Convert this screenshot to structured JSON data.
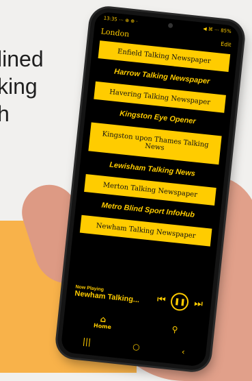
{
  "backdrop": {
    "text_lines": [
      "lined",
      "king",
      "h"
    ]
  },
  "statusbar": {
    "time": "13:35 ⋯ ⊕ ⊕ ·",
    "icons": "◀ ⌘ ⋯ 85%"
  },
  "header": {
    "title": "London",
    "edit_label": "Edit"
  },
  "list": [
    {
      "label": "Enfield Talking Newspaper",
      "style": "yellow"
    },
    {
      "label": "Harrow Talking Newspaper",
      "style": "dark"
    },
    {
      "label": "Havering Talking Newspaper",
      "style": "yellow"
    },
    {
      "label": "Kingston Eye Opener",
      "style": "dark"
    },
    {
      "label": "Kingston upon Thames Talking News",
      "style": "yellow"
    },
    {
      "label": "Lewisham Talking News",
      "style": "dark"
    },
    {
      "label": "Merton Talking Newspaper",
      "style": "yellow"
    },
    {
      "label": "Metro Blind Sport InfoHub",
      "style": "dark"
    },
    {
      "label": "Newham Talking Newspaper",
      "style": "yellow"
    }
  ],
  "now_playing": {
    "label": "Now Playing",
    "title": "Newham Talking..."
  },
  "tabs": {
    "home_label": "Home",
    "home_icon": "home-icon",
    "search_icon": "search-icon"
  },
  "colors": {
    "accent": "#ffcc00",
    "background": "#000000"
  }
}
